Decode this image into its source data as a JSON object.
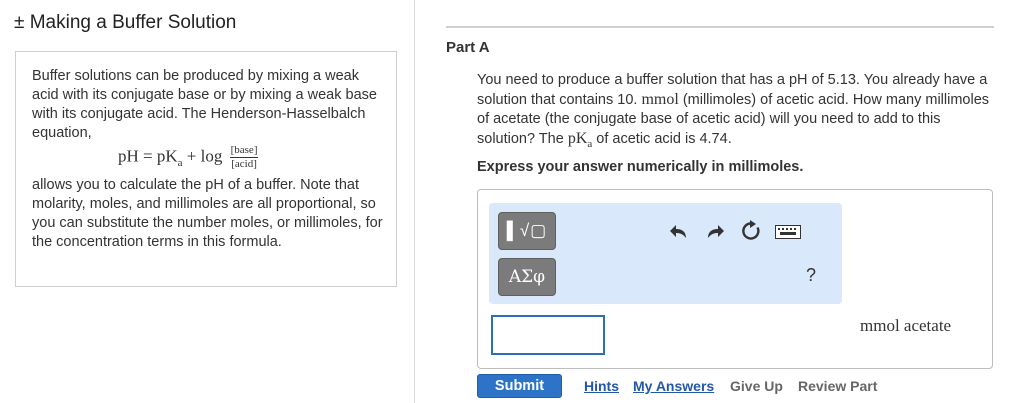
{
  "left_panel": {
    "title": "± Making a Buffer Solution",
    "intro_p1": "Buffer solutions can be produced by mixing a weak acid with its conjugate base or by mixing a weak base with its conjugate acid. The Henderson-Hasselbalch equation,",
    "equation": {
      "lhs": "pH = pK",
      "subscript": "a",
      "plus_log": " + log ",
      "numerator": "[base]",
      "denominator": "[acid]"
    },
    "intro_p2": "allows you to calculate the pH of a buffer. Note that molarity, moles, and millimoles are all proportional, so you can substitute the number moles, or millimoles, for the concentration terms in this formula."
  },
  "part": {
    "label": "Part A",
    "question_1": "You need to produce a buffer solution that has a pH of 5.13. You already have a solution that contains 10. ",
    "question_mmol": "mmol",
    "question_2": " (millimoles) of acetic acid. How many millimoles of acetate (the conjugate base of acetic acid) will you need to add to this solution? The ",
    "question_pka": "pK",
    "question_pka_sub": "a",
    "question_3": " of acetic acid is 4.74.",
    "instruction": "Express your answer numerically in millimoles."
  },
  "toolbar": {
    "template_label": "▌√▢",
    "symbols_label": "ΑΣφ",
    "help_label": "?"
  },
  "answer": {
    "value": "",
    "unit": "mmol acetate"
  },
  "actions": {
    "submit": "Submit",
    "hints": "Hints",
    "my_answers": "My Answers",
    "give_up": "Give Up",
    "review_part": "Review Part"
  },
  "colors": {
    "toolbar_bg": "#d9e8fb",
    "submit_bg": "#2d74c9",
    "link": "#2457a6",
    "input_border": "#2c6fb7"
  }
}
